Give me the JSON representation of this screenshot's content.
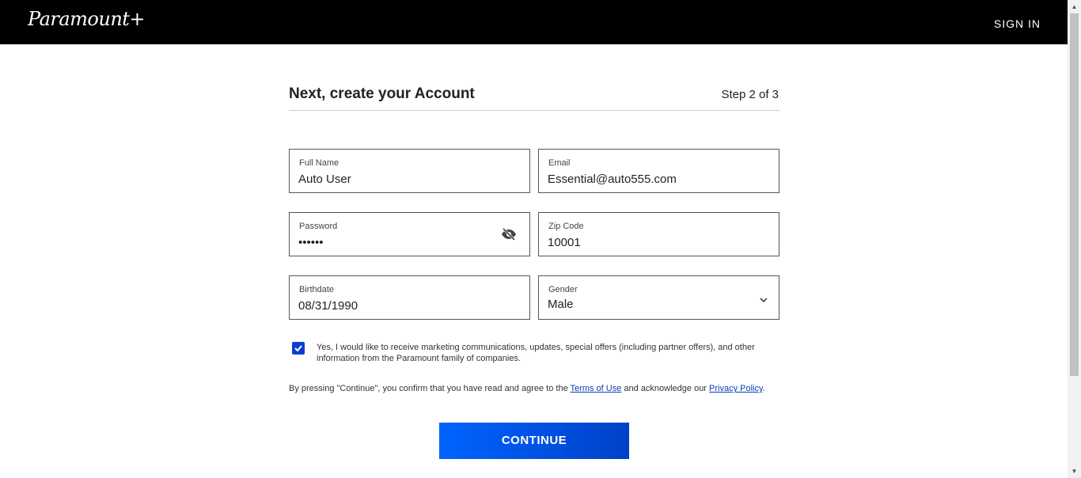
{
  "header": {
    "logo_text": "Paramount+",
    "signin_label": "SIGN IN"
  },
  "form": {
    "heading": "Next, create your Account",
    "step": "Step 2 of 3",
    "fields": {
      "full_name": {
        "label": "Full Name",
        "value": "Auto User"
      },
      "email": {
        "label": "Email",
        "value": "Essential@auto555.com"
      },
      "password": {
        "label": "Password",
        "value": "••••••"
      },
      "zip": {
        "label": "Zip Code",
        "value": "10001"
      },
      "birthdate": {
        "label": "Birthdate",
        "value": "08/31/1990"
      },
      "gender": {
        "label": "Gender",
        "value": "Male"
      }
    },
    "marketing_consent": {
      "checked": true,
      "text": "Yes, I would like to receive marketing communications, updates, special offers (including partner offers), and other information from the Paramount family of companies."
    },
    "legal": {
      "prefix": "By pressing \"Continue\", you confirm that you have read and agree to the ",
      "terms_link": "Terms of Use",
      "middle": " and acknowledge our ",
      "privacy_link": "Privacy Policy",
      "suffix": "."
    },
    "continue_label": "CONTINUE"
  },
  "colors": {
    "accent": "#0064ff",
    "checkbox": "#0b3fd1",
    "link": "#0a3fb5"
  }
}
